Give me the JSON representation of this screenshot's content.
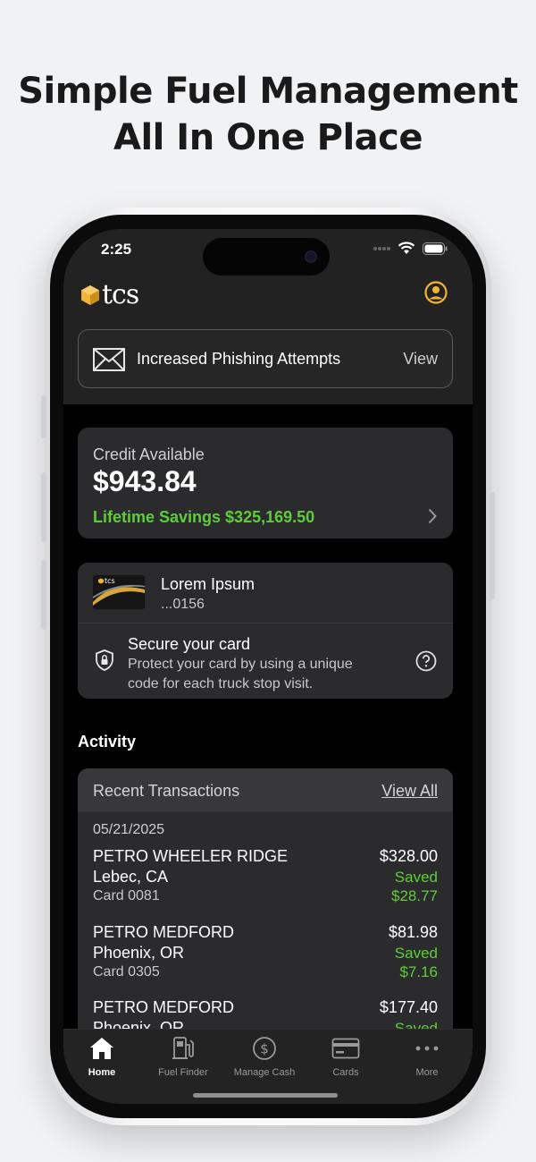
{
  "headline": {
    "line1": "Simple Fuel Management",
    "line2": "All In One Place"
  },
  "status_bar": {
    "time": "2:25"
  },
  "header": {
    "logo_text": "tcs",
    "profile_icon": "user-circle-icon",
    "accent_color": "#f0b533"
  },
  "alert": {
    "icon": "envelope-icon",
    "text": "Increased Phishing Attempts",
    "action": "View"
  },
  "credit": {
    "label": "Credit Available",
    "amount": "$943.84",
    "lifetime_savings": "Lifetime Savings $325,169.50",
    "savings_color": "#5fcd3a"
  },
  "fuel_card": {
    "name": "Lorem Ipsum",
    "number": "...0156",
    "thumb_text": "tcs",
    "secure_title": "Secure your card",
    "secure_desc": "Protect your card by using a unique code for each truck stop visit."
  },
  "activity": {
    "title": "Activity",
    "recent_label": "Recent Transactions",
    "view_all": "View All",
    "date": "05/21/2025",
    "transactions": [
      {
        "name": "PETRO WHEELER RIDGE",
        "city": "Lebec, CA",
        "card": "Card 0081",
        "amount": "$328.00",
        "saved_label": "Saved",
        "saved_amount": "$28.77"
      },
      {
        "name": "PETRO MEDFORD",
        "city": "Phoenix, OR",
        "card": "Card 0305",
        "amount": "$81.98",
        "saved_label": "Saved",
        "saved_amount": "$7.16"
      },
      {
        "name": "PETRO MEDFORD",
        "city": "Phoenix, OR",
        "card": "",
        "amount": "$177.40",
        "saved_label": "Saved",
        "saved_amount": ""
      }
    ]
  },
  "tabs": [
    {
      "label": "Home",
      "icon": "home-icon",
      "active": true
    },
    {
      "label": "Fuel Finder",
      "icon": "fuel-pump-icon",
      "active": false
    },
    {
      "label": "Manage Cash",
      "icon": "dollar-circle-icon",
      "active": false
    },
    {
      "label": "Cards",
      "icon": "card-icon",
      "active": false
    },
    {
      "label": "More",
      "icon": "more-dots-icon",
      "active": false
    }
  ]
}
